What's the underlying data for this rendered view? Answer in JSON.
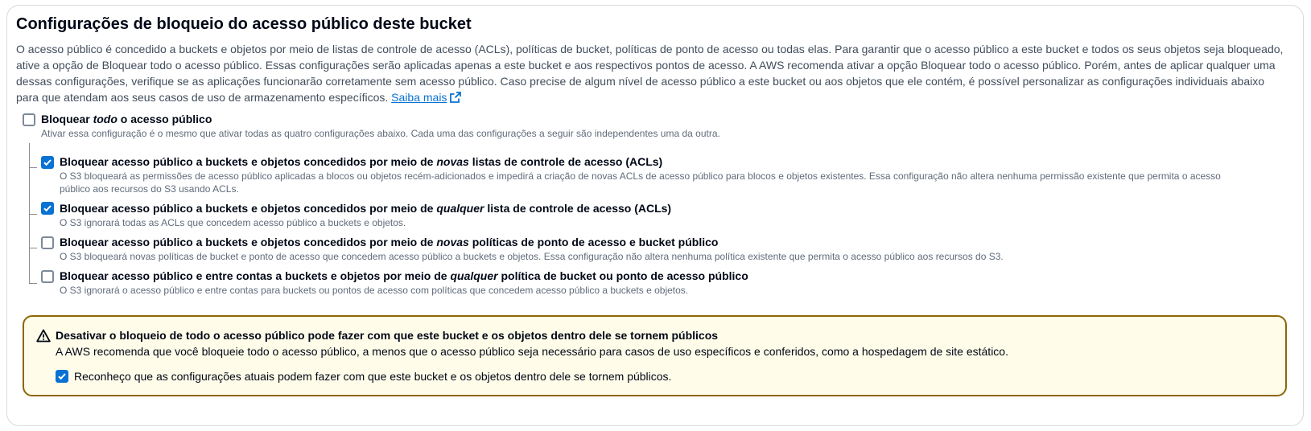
{
  "section": {
    "title": "Configurações de bloqueio do acesso público deste bucket",
    "description_lines": [
      "O acesso público é concedido a buckets e objetos por meio de listas de controle de acesso (ACLs), políticas de bucket, políticas de ponto de acesso ou todas elas. Para garantir que o acesso público a este bucket e todos os seus objetos seja bloqueado,",
      "ative a opção de Bloquear todo o acesso público. Essas configurações serão aplicadas apenas a este bucket e aos respectivos pontos de acesso. A AWS recomenda ativar a opção Bloquear todo o acesso público. Porém, antes de aplicar qualquer uma",
      "dessas configurações, verifique se as aplicações funcionarão corretamente sem acesso público. Caso precise de algum nível de acesso público a este bucket ou aos objetos que ele contém, é possível personalizar as configurações individuais abaixo",
      "para que atendam aos seus casos de uso de armazenamento específicos."
    ],
    "learn_more": "Saiba mais"
  },
  "block_all": {
    "label_before": "Bloquear ",
    "label_em": "todo",
    "label_after": " o acesso público",
    "description": "Ativar essa configuração é o mesmo que ativar todas as quatro configurações abaixo. Cada uma das configurações a seguir são independentes uma da outra.",
    "checked": false
  },
  "options": [
    {
      "label_before": "Bloquear acesso público a buckets e objetos concedidos por meio de ",
      "label_em": "novas",
      "label_after": " listas de controle de acesso (ACLs)",
      "description": "O S3 bloqueará as permissões de acesso público aplicadas a blocos ou objetos recém-adicionados e impedirá a criação de novas ACLs de acesso público para blocos e objetos existentes. Essa configuração não altera nenhuma permissão existente que permita o acesso público aos recursos do S3 usando ACLs.",
      "checked": true
    },
    {
      "label_before": "Bloquear acesso público a buckets e objetos concedidos por meio de ",
      "label_em": "qualquer",
      "label_after": " lista de controle de acesso (ACLs)",
      "description": "O S3 ignorará todas as ACLs que concedem acesso público a buckets e objetos.",
      "checked": true
    },
    {
      "label_before": "Bloquear acesso público a buckets e objetos concedidos por meio de ",
      "label_em": "novas",
      "label_after": " políticas de ponto de acesso e bucket público",
      "description": "O S3 bloqueará novas políticas de bucket e ponto de acesso que concedem acesso público a buckets e objetos. Essa configuração não altera nenhuma política existente que permita o acesso público aos recursos do S3.",
      "checked": false
    },
    {
      "label_before": "Bloquear acesso público e entre contas a buckets e objetos por meio de ",
      "label_em": "qualquer",
      "label_after": " política de bucket ou ponto de acesso público",
      "description": "O S3 ignorará o acesso público e entre contas para buckets ou pontos de acesso com políticas que concedem acesso público a buckets e objetos.",
      "checked": false
    }
  ],
  "warning": {
    "icon": "warning-icon",
    "title": "Desativar o bloqueio de todo o acesso público pode fazer com que este bucket e os objetos dentro dele se tornem públicos",
    "text": "A AWS recomenda que você bloqueie todo o acesso público, a menos que o acesso público seja necessário para casos de uso específicos e conferidos, como a hospedagem de site estático.",
    "acknowledge_label": "Reconheço que as configurações atuais podem fazer com que este bucket e os objetos dentro dele se tornem públicos.",
    "acknowledge_checked": true
  },
  "colors": {
    "accent": "#0972d3",
    "warning_border": "#8d6605",
    "warning_bg": "#fffce9"
  }
}
